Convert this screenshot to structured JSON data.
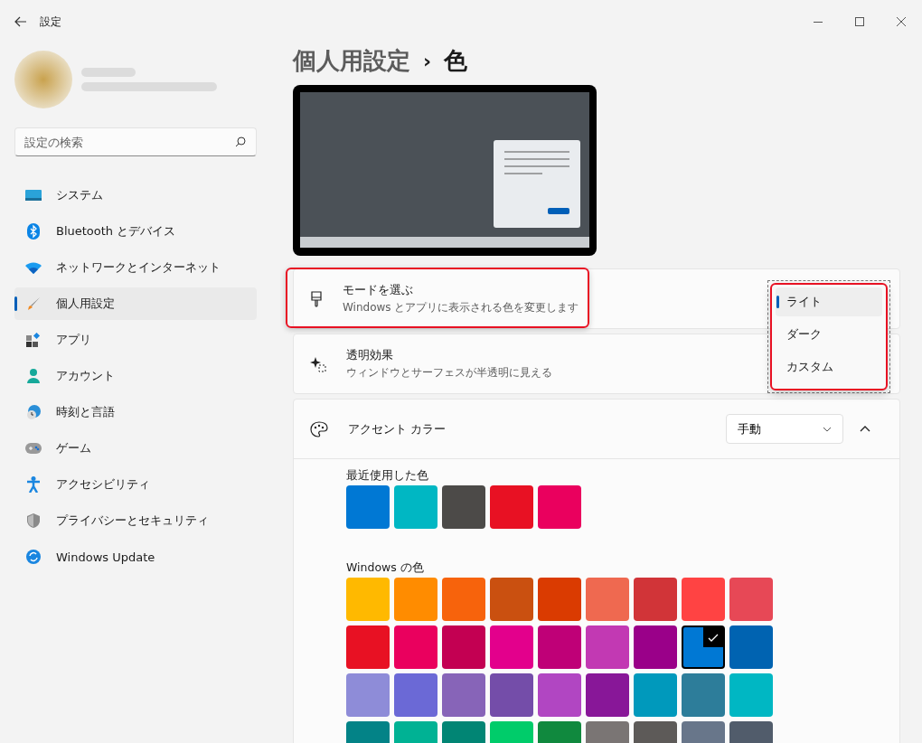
{
  "window": {
    "title": "設定"
  },
  "search": {
    "placeholder": "設定の検索"
  },
  "nav": [
    {
      "label": "システム",
      "selected": false
    },
    {
      "label": "Bluetooth とデバイス",
      "selected": false
    },
    {
      "label": "ネットワークとインターネット",
      "selected": false
    },
    {
      "label": "個人用設定",
      "selected": true
    },
    {
      "label": "アプリ",
      "selected": false
    },
    {
      "label": "アカウント",
      "selected": false
    },
    {
      "label": "時刻と言語",
      "selected": false
    },
    {
      "label": "ゲーム",
      "selected": false
    },
    {
      "label": "アクセシビリティ",
      "selected": false
    },
    {
      "label": "プライバシーとセキュリティ",
      "selected": false
    },
    {
      "label": "Windows Update",
      "selected": false
    }
  ],
  "breadcrumb": {
    "parent": "個人用設定",
    "separator": "›",
    "current": "色"
  },
  "settings": [
    {
      "kind": "mode",
      "title": "モードを選ぶ",
      "subtitle": "Windows とアプリに表示される色を変更します",
      "highlighted": true
    },
    {
      "kind": "transparency",
      "title": "透明効果",
      "subtitle": "ウィンドウとサーフェスが半透明に見える",
      "highlighted": false
    }
  ],
  "mode_menu": {
    "highlighted": true,
    "options": [
      {
        "label": "ライト",
        "selected": true
      },
      {
        "label": "ダーク",
        "selected": false
      },
      {
        "label": "カスタム",
        "selected": false
      }
    ]
  },
  "accent": {
    "title": "アクセント カラー",
    "dropdown": "手動",
    "expanded": true,
    "recent_label": "最近使用した色",
    "recent": [
      {
        "color": "#0078d4"
      },
      {
        "color": "#00b7c3"
      },
      {
        "color": "#4c4a48"
      },
      {
        "color": "#e81123"
      },
      {
        "color": "#ea005e"
      }
    ],
    "windows_label": "Windows の色",
    "windows_colors": [
      {
        "color": "#ffb900",
        "selected": false
      },
      {
        "color": "#ff8c00",
        "selected": false
      },
      {
        "color": "#f7630c",
        "selected": false
      },
      {
        "color": "#ca5010",
        "selected": false
      },
      {
        "color": "#da3b01",
        "selected": false
      },
      {
        "color": "#ef6950",
        "selected": false
      },
      {
        "color": "#d13438",
        "selected": false
      },
      {
        "color": "#ff4343",
        "selected": false
      },
      {
        "color": "#e74856",
        "selected": false
      },
      {
        "color": "#e81123",
        "selected": false
      },
      {
        "color": "#ea005e",
        "selected": false
      },
      {
        "color": "#c30052",
        "selected": false
      },
      {
        "color": "#e3008c",
        "selected": false
      },
      {
        "color": "#bf0077",
        "selected": false
      },
      {
        "color": "#c239b3",
        "selected": false
      },
      {
        "color": "#9a0089",
        "selected": false
      },
      {
        "color": "#0078d4",
        "selected": true
      },
      {
        "color": "#0063b1",
        "selected": false
      },
      {
        "color": "#8e8cd8",
        "selected": false
      },
      {
        "color": "#6b69d6",
        "selected": false
      },
      {
        "color": "#8764b8",
        "selected": false
      },
      {
        "color": "#744da9",
        "selected": false
      },
      {
        "color": "#b146c2",
        "selected": false
      },
      {
        "color": "#881798",
        "selected": false
      },
      {
        "color": "#0099bc",
        "selected": false
      },
      {
        "color": "#2d7d9a",
        "selected": false
      },
      {
        "color": "#00b7c3",
        "selected": false
      },
      {
        "color": "#038387",
        "selected": false
      },
      {
        "color": "#00b294",
        "selected": false
      },
      {
        "color": "#018574",
        "selected": false
      },
      {
        "color": "#00cc6a",
        "selected": false
      },
      {
        "color": "#10893e",
        "selected": false
      },
      {
        "color": "#7a7574",
        "selected": false
      },
      {
        "color": "#5d5a58",
        "selected": false
      },
      {
        "color": "#68768a",
        "selected": false
      },
      {
        "color": "#515c6b",
        "selected": false
      }
    ]
  }
}
